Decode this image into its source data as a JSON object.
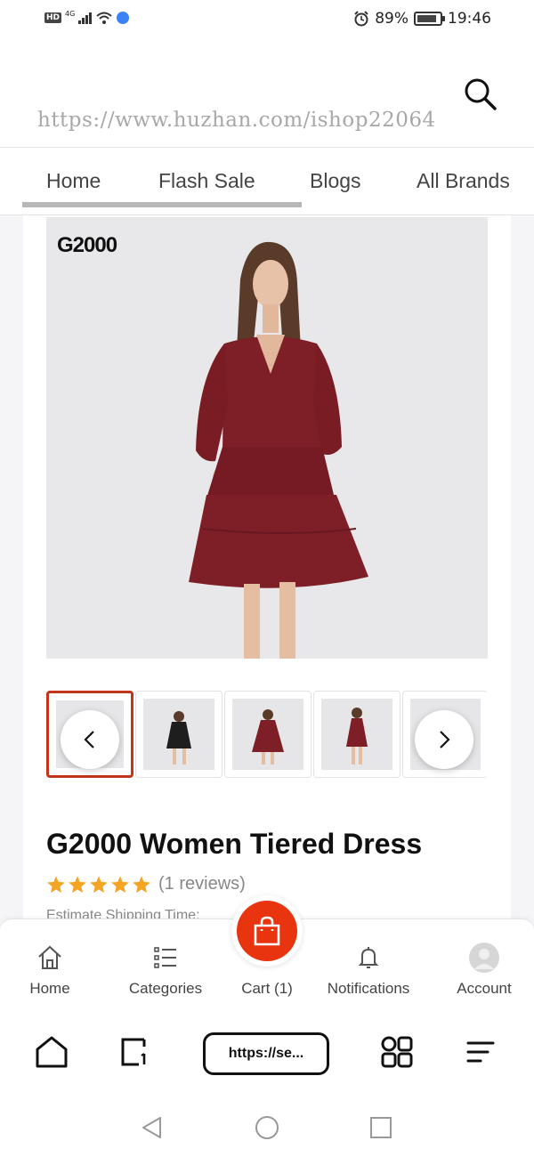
{
  "status_bar": {
    "hd": "HD",
    "network": "4G",
    "battery": "89%",
    "battery_level": 0.89,
    "time": "19:46"
  },
  "header": {
    "watermark": "https://www.huzhan.com/ishop22064",
    "search_icon": "search-icon"
  },
  "nav_tabs": [
    {
      "label": "Home",
      "active": true
    },
    {
      "label": "Flash Sale"
    },
    {
      "label": "Blogs"
    },
    {
      "label": "All Brands"
    }
  ],
  "product": {
    "brand_logo": "G2000",
    "title": "G2000 Women Tiered Dress",
    "rating": 5,
    "reviews": "(1 reviews)",
    "shipping": "Estimate Shipping Time:",
    "thumbnail_count": 5,
    "active_thumbnail": 1,
    "colors": {
      "dress": "#7e1f27",
      "accent": "#c2351b",
      "star": "#f5a524"
    }
  },
  "bottom_nav": [
    {
      "label": "Home",
      "icon": "home-icon"
    },
    {
      "label": "Categories",
      "icon": "categories-icon"
    },
    {
      "label": "Cart (1)",
      "icon": "cart-icon"
    },
    {
      "label": "Notifications",
      "icon": "bell-icon"
    },
    {
      "label": "Account",
      "icon": "avatar-icon"
    }
  ],
  "browser": {
    "url": "https://se..."
  },
  "colors": {
    "brand_red": "#e8340f"
  }
}
